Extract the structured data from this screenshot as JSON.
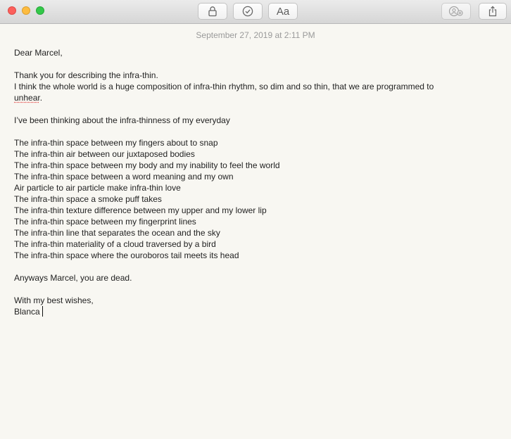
{
  "toolbar": {
    "font_button_label": "Aa"
  },
  "note": {
    "date": "September 27, 2019 at 2:11 PM",
    "greeting": "Dear Marcel,",
    "para1_line1": "Thank you for describing the infra-thin.",
    "para1_line2": "I think the whole world is a huge composition of infra-thin rhythm, so dim and so thin, that we are programmed to",
    "para1_line3_word": "unhear",
    "para1_line3_end": ".",
    "para2": "I’ve been thinking about the infra-thinness of my everyday",
    "list": [
      "The infra-thin space between my fingers about to snap",
      "The infra-thin air between our juxtaposed bodies",
      "The infra-thin space between my body and my inability to feel the world",
      "The infra-thin space between a word meaning and my own",
      "Air particle to air particle make infra-thin love",
      "The infra-thin space a smoke puff takes",
      "The infra-thin texture difference between my upper and my lower lip",
      "The infra-thin space between my fingerprint lines",
      "The infra-thin line that separates the ocean and the sky",
      "The infra-thin materiality of a cloud traversed by a bird",
      "The infra-thin space where the ouroboros tail meets its head"
    ],
    "closing": "Anyways Marcel, you are dead.",
    "signoff": "With my best wishes,",
    "signature": "Blanca"
  }
}
